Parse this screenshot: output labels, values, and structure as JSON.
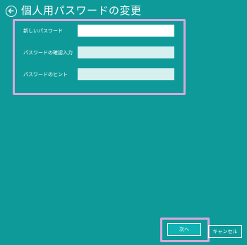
{
  "header": {
    "title": "個人用パスワードの変更",
    "back_icon": "back-arrow-circle-icon"
  },
  "form": {
    "fields": [
      {
        "label": "新しいパスワード",
        "value": "",
        "placeholder": "",
        "state": "active"
      },
      {
        "label": "パスワードの確認入力",
        "value": "",
        "placeholder": "",
        "state": "inactive"
      },
      {
        "label": "パスワードのヒント",
        "value": "",
        "placeholder": "",
        "state": "inactive"
      }
    ]
  },
  "footer": {
    "next_label": "次へ",
    "cancel_label": "キャンセル"
  },
  "colors": {
    "background": "#0f9a9a",
    "highlight_frame": "#d8a8da",
    "input_active": "#ffffff",
    "input_inactive": "#d6efef",
    "primary_button": "#0fb3b3"
  }
}
